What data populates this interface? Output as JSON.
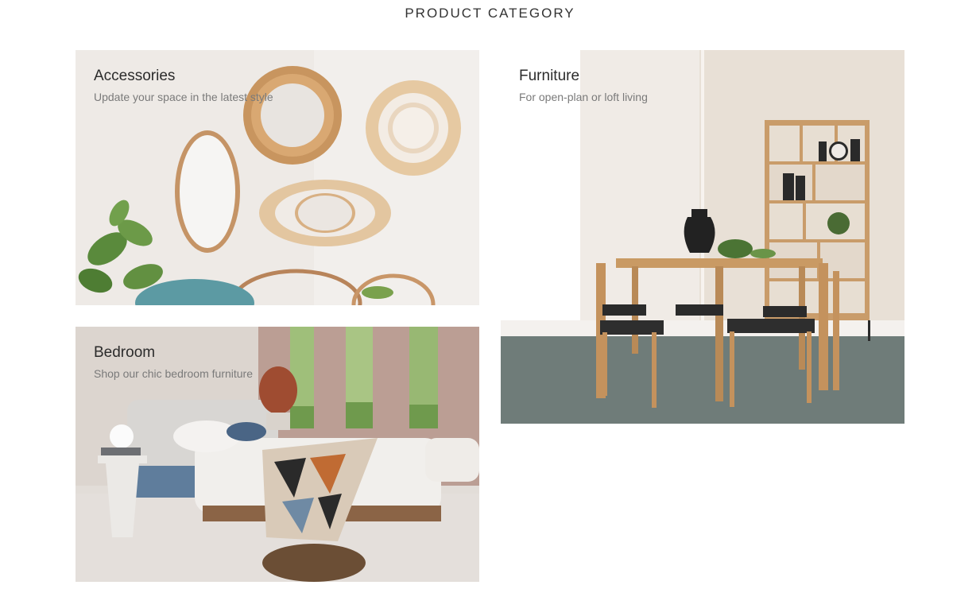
{
  "section": {
    "title": "PRODUCT CATEGORY"
  },
  "categories": {
    "accessories": {
      "title": "Accessories",
      "subtitle": "Update your space in the latest style",
      "image_icon": "mirrors-wall-image"
    },
    "furniture": {
      "title": "Furniture",
      "subtitle": "For open-plan or loft living",
      "image_icon": "dining-set-image"
    },
    "bedroom": {
      "title": "Bedroom",
      "subtitle": "Shop our chic bedroom furniture",
      "image_icon": "bedroom-scene-image"
    }
  }
}
